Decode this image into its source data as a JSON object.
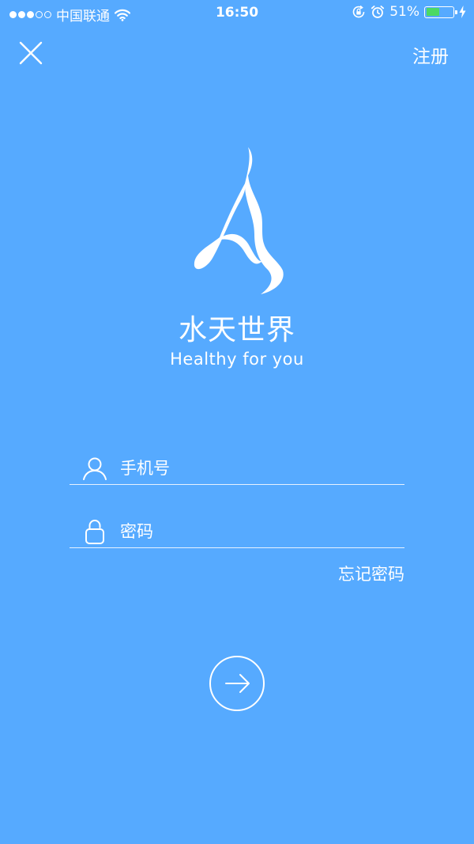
{
  "status_bar": {
    "carrier": "中国联通",
    "time": "16:50",
    "battery_percent": "51%",
    "battery_level": 0.51,
    "signal_bars_filled": 3,
    "signal_bars_total": 5,
    "battery_color": "#4cd964"
  },
  "header": {
    "close_icon": "close-icon",
    "register_label": "注册"
  },
  "brand": {
    "name": "水天世界",
    "slogan": "Healthy for you"
  },
  "form": {
    "phone_placeholder": "手机号",
    "password_placeholder": "密码",
    "forgot_label": "忘记密码",
    "submit_icon": "arrow-right-icon"
  },
  "theme": {
    "background": "#56aaff"
  }
}
